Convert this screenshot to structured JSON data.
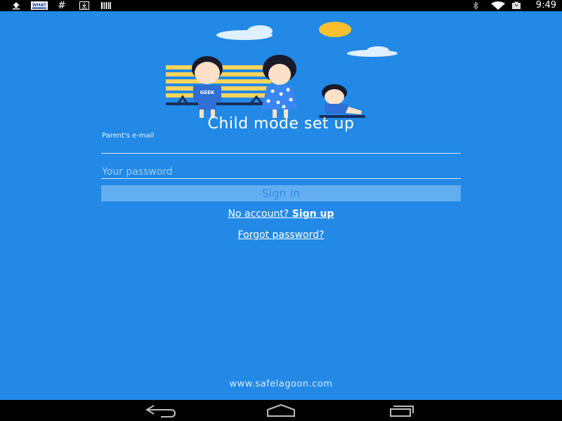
{
  "status_bar": {
    "left_icons": [
      "upload-icon",
      "news-app-icon",
      "hashtag-icon",
      "download-icon",
      "barcode-icon"
    ],
    "news_badge_text": "WHAT",
    "right_icons": [
      "bluetooth-icon",
      "wifi-icon",
      "battery-icon"
    ],
    "time": "9:49"
  },
  "colors": {
    "background": "#2289e6",
    "button_bg": "#63aef1",
    "button_text": "#2f8ee6",
    "sun": "#fbc02d"
  },
  "illustration": {
    "shirt_text": "GEEK"
  },
  "title": "Child mode set up",
  "form": {
    "email_label": "Parent's e-mail",
    "email_value": "",
    "password_placeholder": "Your password",
    "signin_label": "Sign in"
  },
  "links": {
    "no_account_text": "No account?",
    "signup_text": "Sign up",
    "forgot_password": "Forgot password?"
  },
  "footer_url": "www.safelagoon.com",
  "nav": {
    "buttons": [
      "back-icon",
      "home-icon",
      "recents-icon"
    ]
  }
}
